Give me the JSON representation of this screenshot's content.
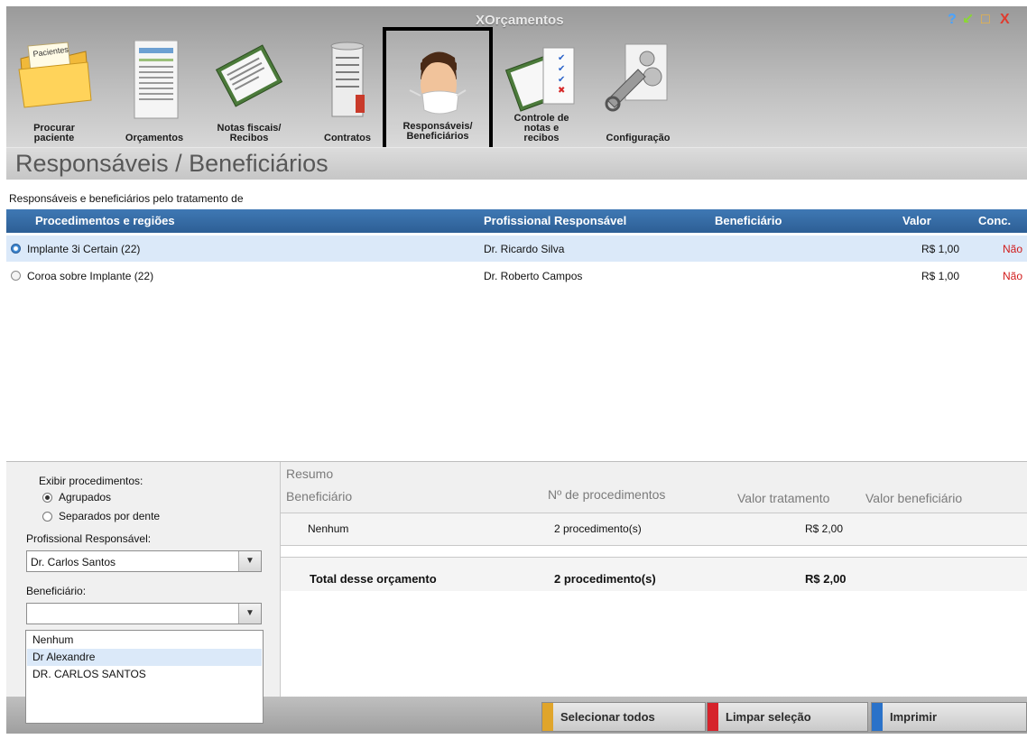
{
  "window": {
    "title": "XOrçamentos",
    "controls": [
      "?",
      "↙",
      "□",
      "X"
    ]
  },
  "toolbar": {
    "items": [
      {
        "label_line1": "Procurar",
        "label_line2": "paciente",
        "folder_tag": "Pacientes"
      },
      {
        "label_line1": "Orçamentos",
        "label_line2": ""
      },
      {
        "label_line1": "Notas fiscais/",
        "label_line2": "Recibos"
      },
      {
        "label_line1": "Contratos",
        "label_line2": ""
      },
      {
        "label_line1": "Responsáveis/",
        "label_line2": "Beneficiários"
      },
      {
        "label_line1": "Controle de",
        "label_line2": "notas e",
        "label_line3": "recibos"
      },
      {
        "label_line1": "Configuração",
        "label_line2": ""
      }
    ]
  },
  "page": {
    "title": "Responsáveis / Beneficiários",
    "subtitle": "Responsáveis e beneficiários pelo tratamento de"
  },
  "table": {
    "headers": {
      "procedimentos": "Procedimentos e regiões",
      "profissional": "Profissional Responsável",
      "beneficiario": "Beneficiário",
      "valor": "Valor",
      "conc": "Conc."
    },
    "rows": [
      {
        "procedimento": "Implante 3i Certain (22)",
        "profissional": "Dr. Ricardo Silva",
        "beneficiario": "",
        "valor": "R$ 1,00",
        "conc": "Não",
        "selected": true
      },
      {
        "procedimento": "Coroa sobre Implante (22)",
        "profissional": "Dr. Roberto Campos",
        "beneficiario": "",
        "valor": "R$ 1,00",
        "conc": "Não",
        "selected": false
      }
    ]
  },
  "filters": {
    "exibir_label": "Exibir procedimentos:",
    "option_agrupados": "Agrupados",
    "option_separados": "Separados por dente",
    "selected_option": "Agrupados",
    "profissional_label": "Profissional Responsável:",
    "profissional_value": "Dr. Carlos Santos",
    "beneficiario_label": "Beneficiário:",
    "beneficiario_value": "",
    "beneficiario_options": [
      "Nenhum",
      "Dr Alexandre",
      "DR. CARLOS SANTOS"
    ],
    "beneficiario_highlighted": "Dr Alexandre"
  },
  "resumo": {
    "title": "Resumo",
    "headers": {
      "beneficiario": "Beneficiário",
      "num_proc": "Nº de procedimentos",
      "valor_trat": "Valor tratamento",
      "valor_benef": "Valor beneficiário"
    },
    "rows": [
      {
        "beneficiario": "Nenhum",
        "num_proc": "2 procedimento(s)",
        "valor_trat": "R$ 2,00",
        "valor_benef": ""
      }
    ],
    "total": {
      "label": "Total desse orçamento",
      "num_proc": "2 procedimento(s)",
      "valor_trat": "R$ 2,00"
    }
  },
  "footer": {
    "select_all": "Selecionar todos",
    "clear": "Limpar seleção",
    "print": "Imprimir"
  },
  "colors": {
    "accent_blue": "#2d5f95",
    "selected_row": "#dbe9f9",
    "no_red": "#d11a1a",
    "btn_yellow": "#e0a52b",
    "btn_red": "#d6232b",
    "btn_blue": "#2a72c9"
  }
}
